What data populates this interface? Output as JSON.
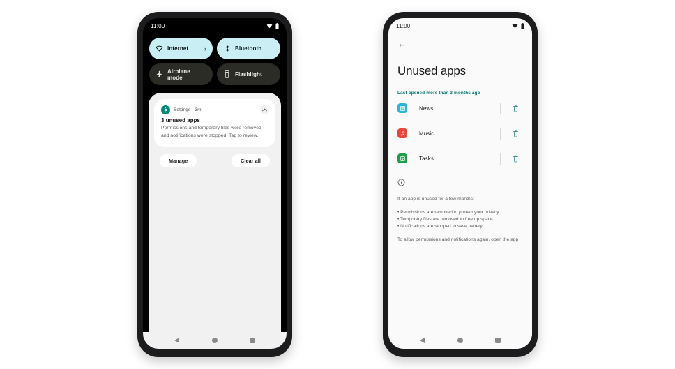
{
  "left_phone": {
    "status_bar": {
      "time": "11:00",
      "wifi_icon": "wifi-icon",
      "battery_icon": "battery-icon"
    },
    "quick_settings": {
      "tiles": [
        {
          "label": "Internet",
          "icon": "wifi-icon",
          "state": "on",
          "has_chevron": true,
          "chevron": "›"
        },
        {
          "label": "Bluetooth",
          "icon": "bluetooth-icon",
          "state": "on",
          "has_chevron": false
        },
        {
          "label": "Airplane mode",
          "icon": "airplane-icon",
          "state": "off",
          "has_chevron": false
        },
        {
          "label": "Flashlight",
          "icon": "flashlight-icon",
          "state": "off",
          "has_chevron": false
        }
      ]
    },
    "notification": {
      "app_icon": "settings-gear-icon",
      "meta": "Settings · 3m",
      "title": "3 unused apps",
      "body": "Permissions and temporary files were removed and notifications were stopped. Tap to review.",
      "collapse_icon": "chevron-up-icon"
    },
    "shade_actions": {
      "manage": "Manage",
      "clear_all": "Clear all"
    },
    "nav_bar": {
      "back": "back-triangle-icon",
      "home": "home-circle-icon",
      "recents": "recents-square-icon"
    }
  },
  "right_phone": {
    "status_bar": {
      "time": "11:00",
      "wifi_icon": "wifi-icon",
      "battery_icon": "battery-icon"
    },
    "back_arrow": "←",
    "title": "Unused apps",
    "section_label": "Last opened more than 3 months ago",
    "apps": [
      {
        "name": "News",
        "icon": "news-app-icon",
        "color": "#29b6d8",
        "glyph": "☰",
        "delete_icon": "trash-icon"
      },
      {
        "name": "Music",
        "icon": "music-app-icon",
        "color": "#e8453c",
        "glyph": "♪",
        "delete_icon": "trash-icon"
      },
      {
        "name": "Tasks",
        "icon": "tasks-app-icon",
        "color": "#1e9e4a",
        "glyph": "✓",
        "delete_icon": "trash-icon"
      }
    ],
    "info": {
      "icon": "info-circle-icon",
      "intro": "If an app is unused for a few months:",
      "bullets": [
        "• Permissions are removed to protect your privacy",
        "• Temporary files are removed to free up space",
        "• Notifications are stopped to save battery"
      ],
      "footer": "To allow permissions and notifications again, open the app."
    },
    "nav_bar": {
      "back": "back-triangle-icon",
      "home": "home-circle-icon",
      "recents": "recents-square-icon"
    }
  },
  "theme": {
    "tile_on_bg": "#c9eef3",
    "tile_off_bg": "#2c2c27",
    "accent_teal": "#00796b",
    "shade_bg": "#f1f1f1",
    "app_bg": "#fafafa",
    "page_bg": "#ffffff"
  }
}
